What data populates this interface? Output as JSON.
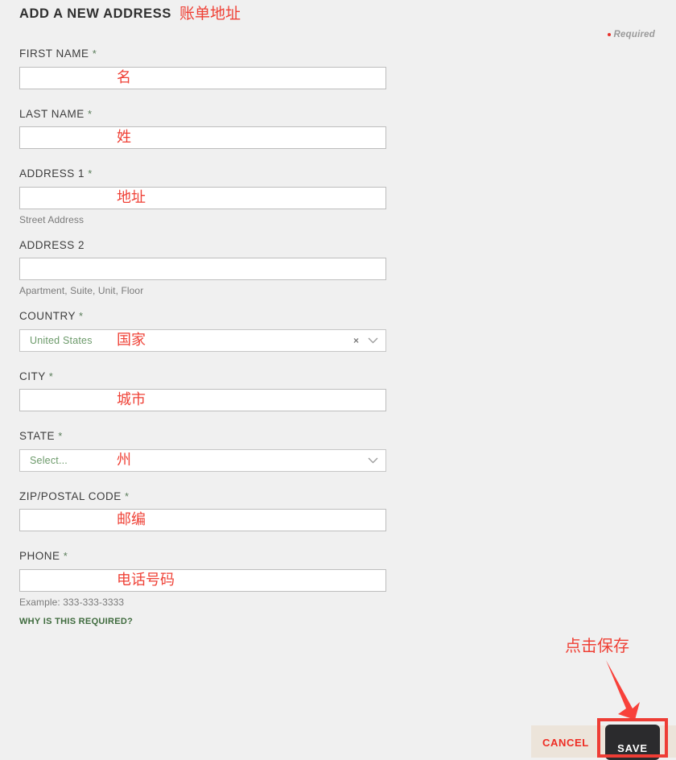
{
  "header": {
    "title": "ADD A NEW ADDRESS",
    "annotation_cn": "账单地址",
    "required_note": "Required"
  },
  "colors": {
    "page_background": "#f0f0f0",
    "annotation_red": "#ef4136",
    "save_button_background": "#2b2b2d",
    "cancel_text": "#ee2d24",
    "footer_background": "#ece4da",
    "select_value_green": "#6c9a6a",
    "help_link_green": "#3f6b3e",
    "required_dot": "#e8312a"
  },
  "form": {
    "fields": [
      {
        "label": "FIRST NAME",
        "required": true,
        "required_marker": "*",
        "type": "text",
        "value": "",
        "annotation_cn": "名",
        "hint": ""
      },
      {
        "label": "LAST NAME",
        "required": true,
        "required_marker": "*",
        "type": "text",
        "value": "",
        "annotation_cn": "姓",
        "hint": ""
      },
      {
        "label": "ADDRESS 1",
        "required": true,
        "required_marker": "*",
        "type": "text",
        "value": "",
        "annotation_cn": "地址",
        "hint": "Street Address"
      },
      {
        "label": "ADDRESS 2",
        "required": false,
        "required_marker": "",
        "type": "text",
        "value": "",
        "annotation_cn": "",
        "hint": "Apartment, Suite, Unit, Floor"
      },
      {
        "label": "COUNTRY",
        "required": true,
        "required_marker": "*",
        "type": "select",
        "value": "United States",
        "annotation_cn": "国家",
        "hint": "",
        "clear_icon": "×",
        "chevron_icon": "chevron-down"
      },
      {
        "label": "CITY",
        "required": true,
        "required_marker": "*",
        "type": "text",
        "value": "",
        "annotation_cn": "城市",
        "hint": ""
      },
      {
        "label": "STATE",
        "required": true,
        "required_marker": "*",
        "type": "select",
        "value": "Select...",
        "annotation_cn": "州",
        "hint": "",
        "chevron_icon": "chevron-down"
      },
      {
        "label": "ZIP/POSTAL CODE",
        "required": true,
        "required_marker": "*",
        "type": "text",
        "value": "",
        "annotation_cn": "邮编",
        "hint": ""
      },
      {
        "label": "PHONE",
        "required": true,
        "required_marker": "*",
        "type": "text",
        "value": "",
        "annotation_cn": "电话号码",
        "hint": "Example: 333-333-3333"
      }
    ],
    "help_link": "WHY IS THIS REQUIRED?"
  },
  "footer": {
    "cancel_label": "CANCEL",
    "save_label": "SAVE"
  },
  "annotations": {
    "save_instruction_cn": "点击保存"
  }
}
